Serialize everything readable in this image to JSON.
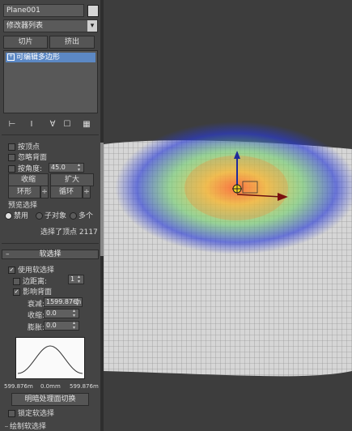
{
  "object": {
    "name": "Plane001",
    "color": "#d7d7d7"
  },
  "modifier_list": {
    "label": "修改器列表"
  },
  "buttons": {
    "slice": "切片",
    "extrude": "挤出"
  },
  "stack": {
    "item": "可编辑多边形"
  },
  "selection": {
    "by_vertex": "按顶点",
    "ignore_backfacing": "忽略背面",
    "by_angle": "按角度:",
    "angle_value": "45.0",
    "shrink": "收缩",
    "grow": "扩大",
    "ring": "环形",
    "loop": "循环",
    "preview_title": "预览选择",
    "preview_off": "禁用",
    "preview_subobject": "子对象",
    "preview_multi": "多个",
    "status": "选择了顶点 2117"
  },
  "soft_selection": {
    "title": "软选择",
    "use_soft": "使用软选择",
    "edge_distance": "边距离:",
    "edge_value": "1",
    "affect_backfacing": "影响背面",
    "falloff_label": "衰减:",
    "falloff_value": "1599.876n",
    "pinch_label": "收缩:",
    "pinch_value": "0.0",
    "bubble_label": "膨胀:",
    "bubble_value": "0.0",
    "graph_left": "599.876m",
    "graph_mid": "0.0mm",
    "graph_right": "599.876m",
    "shaded_face_toggle": "明暗处理面切换",
    "lock_soft": "锁定软选择",
    "paint_soft": "绘制软选择"
  },
  "colors": {
    "viewport_bg": "#3d3d3d",
    "mesh_bg": "#d6d6d6",
    "wire": "#9a9a9a",
    "soft_red": "#ff5a2a",
    "soft_yellow": "#f2d23a",
    "soft_green": "#6ed06a",
    "soft_blue": "#2a3cd8"
  }
}
